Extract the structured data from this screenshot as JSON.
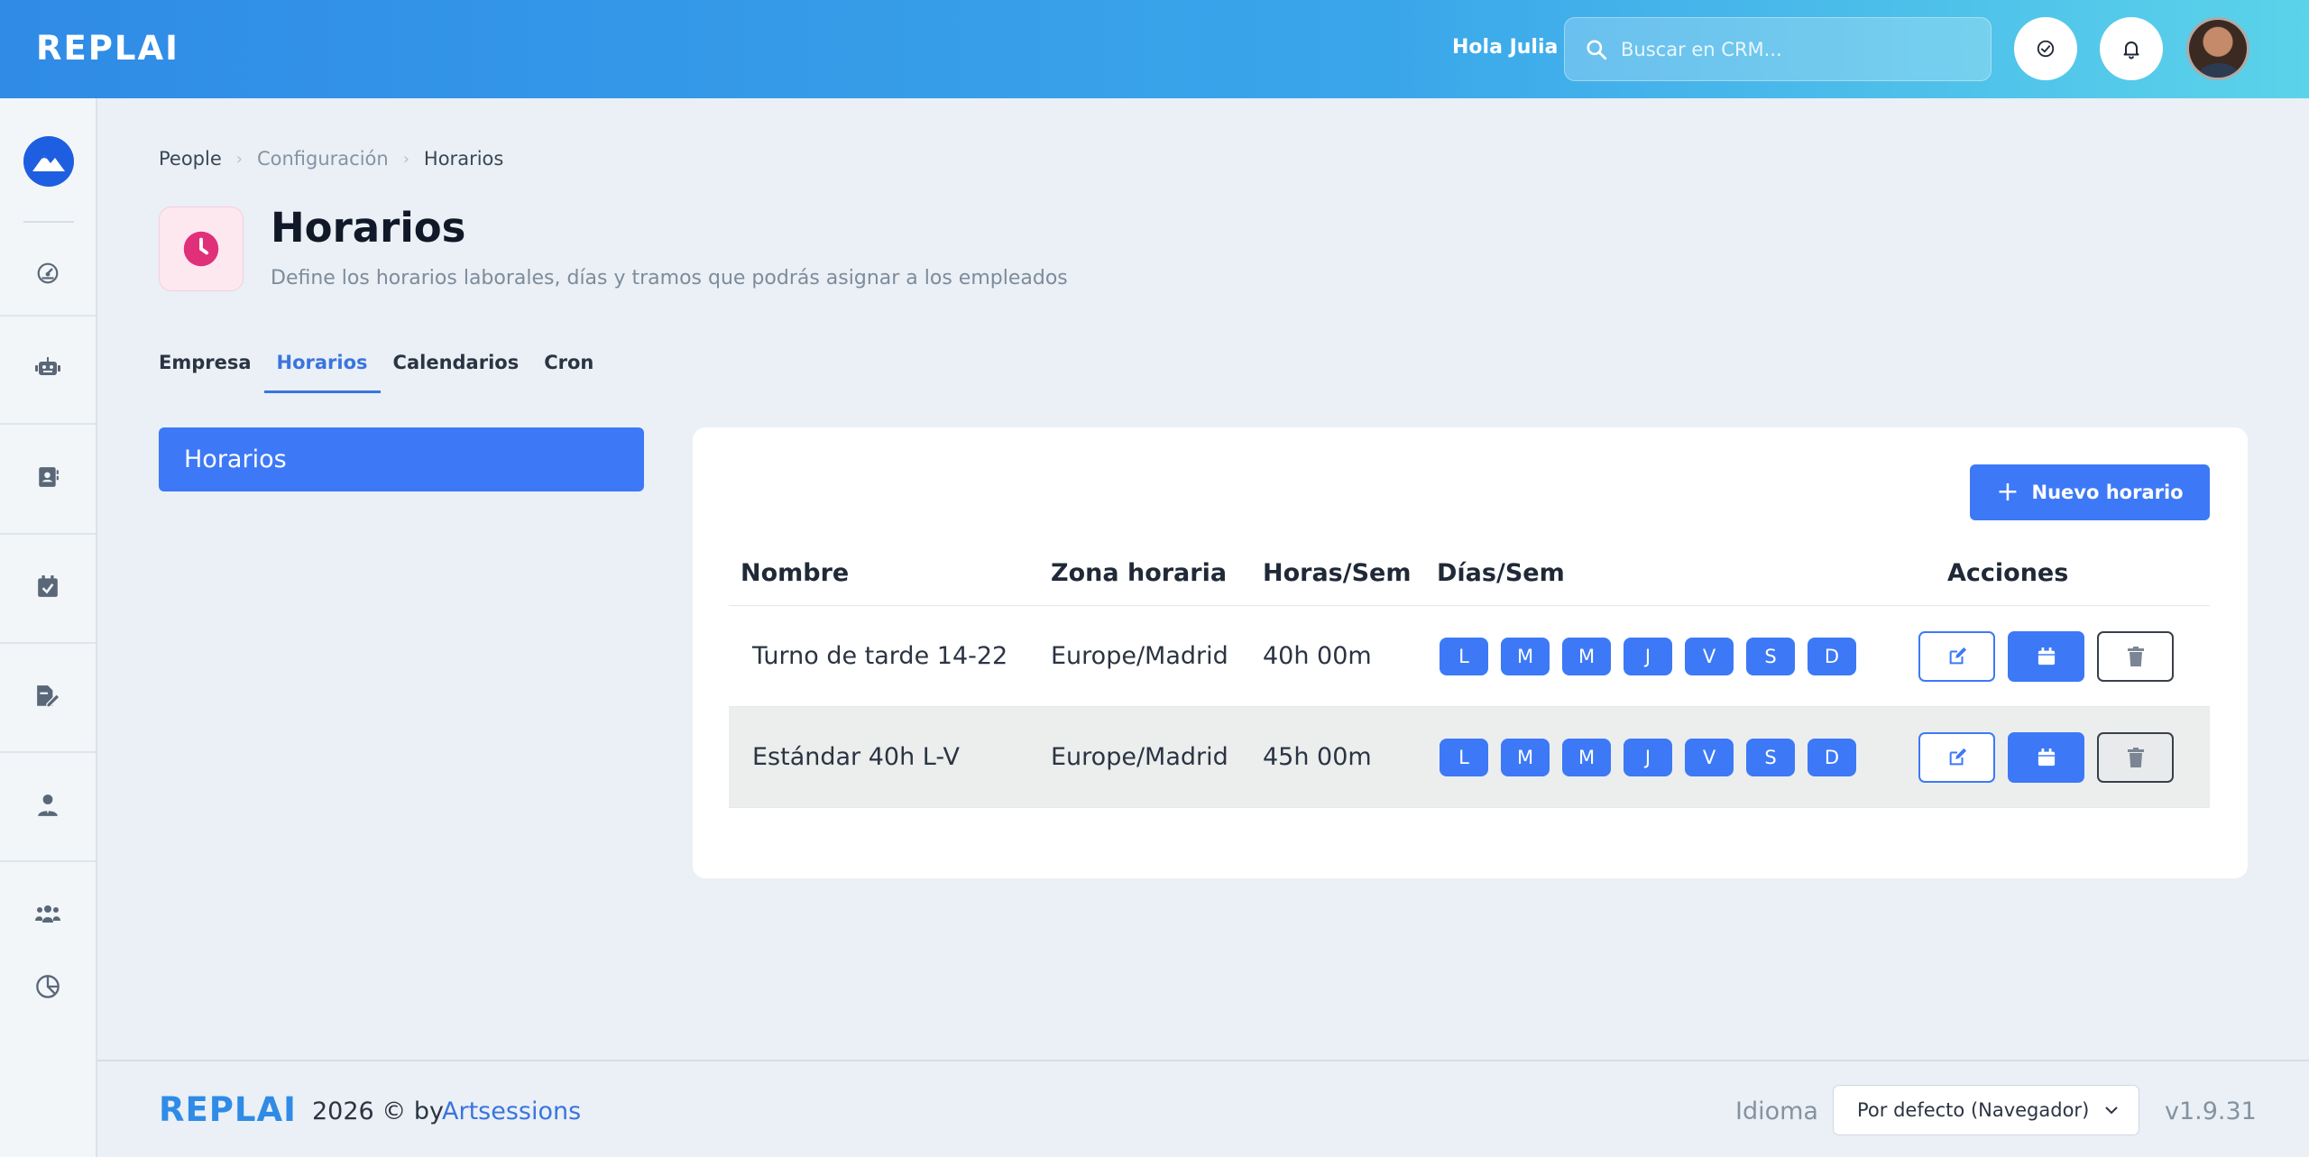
{
  "header": {
    "brand": "REPLAI",
    "greeting": "Hola Julia",
    "search_placeholder": "Buscar en CRM..."
  },
  "sidebar": {
    "items": [
      {
        "icon": "dashboard-icon"
      },
      {
        "icon": "robot-icon"
      },
      {
        "icon": "contacts-icon"
      },
      {
        "icon": "calendar-check-icon"
      },
      {
        "icon": "file-signature-icon"
      },
      {
        "icon": "user-tie-icon"
      },
      {
        "icon": "users-icon"
      },
      {
        "icon": "chart-pie-icon"
      }
    ]
  },
  "breadcrumb": {
    "items": [
      "People",
      "Configuración",
      "Horarios"
    ]
  },
  "page": {
    "title": "Horarios",
    "subtitle": "Define los horarios laborales, días y tramos que podrás asignar a los empleados",
    "accent": "#e0307a"
  },
  "tabs": [
    {
      "label": "Empresa",
      "active": false
    },
    {
      "label": "Horarios",
      "active": true
    },
    {
      "label": "Calendarios",
      "active": false
    },
    {
      "label": "Cron",
      "active": false
    }
  ],
  "side_menu": {
    "label": "Horarios"
  },
  "table": {
    "new_button": "Nuevo horario",
    "columns": [
      "Nombre",
      "Zona horaria",
      "Horas/Sem",
      "Días/Sem",
      "Acciones"
    ],
    "rows": [
      {
        "name": "Turno de tarde 14-22",
        "timezone": "Europe/Madrid",
        "hours": "40h 00m",
        "days": [
          "L",
          "M",
          "M",
          "J",
          "V",
          "S",
          "D"
        ]
      },
      {
        "name": "Estándar 40h L-V",
        "timezone": "Europe/Madrid",
        "hours": "45h 00m",
        "days": [
          "L",
          "M",
          "M",
          "J",
          "V",
          "S",
          "D"
        ]
      }
    ]
  },
  "footer": {
    "brand": "REPLAI",
    "copyright": "2026 © by",
    "author": "Artsessions",
    "language_label": "Idioma",
    "language_value": "Por defecto (Navegador)",
    "version": "v1.9.31"
  },
  "colors": {
    "primary": "#3d79f6",
    "header_start": "#2f8be6",
    "header_end": "#5bd3ea"
  }
}
